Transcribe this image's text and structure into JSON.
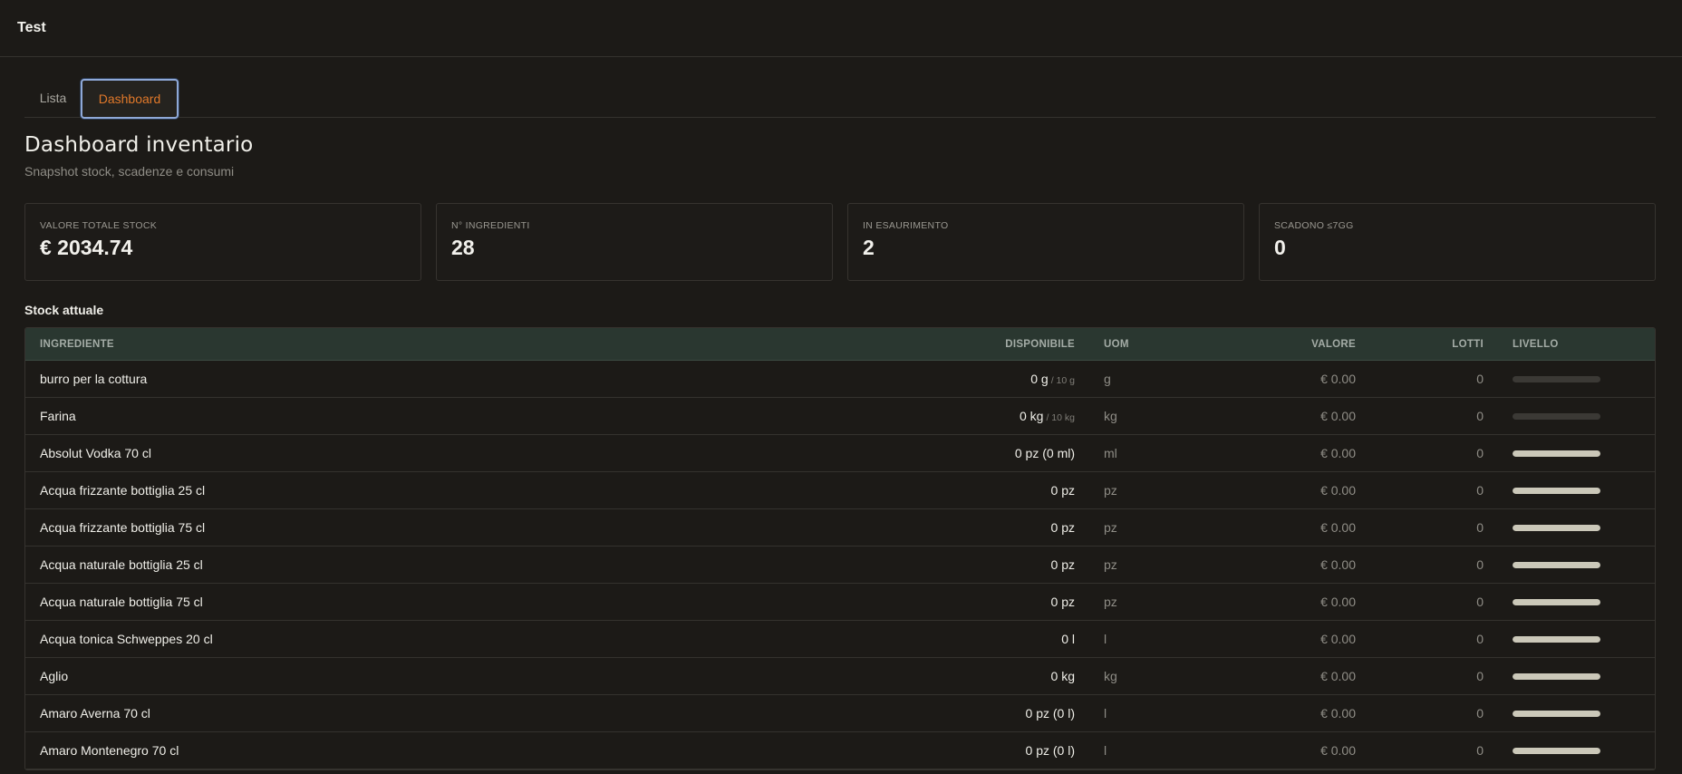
{
  "app": {
    "title": "Test"
  },
  "tabs": [
    {
      "label": "Lista",
      "active": false
    },
    {
      "label": "Dashboard",
      "active": true
    }
  ],
  "page": {
    "title": "Dashboard inventario",
    "subtitle": "Snapshot stock, scadenze e consumi"
  },
  "kpis": [
    {
      "label": "VALORE TOTALE STOCK",
      "value": "€ 2034.74"
    },
    {
      "label": "N° INGREDIENTI",
      "value": "28"
    },
    {
      "label": "IN ESAURIMENTO",
      "value": "2"
    },
    {
      "label": "SCADONO ≤7GG",
      "value": "0"
    }
  ],
  "stock": {
    "title": "Stock attuale",
    "columns": {
      "name": "INGREDIENTE",
      "available": "DISPONIBILE",
      "uom": "UOM",
      "value": "VALORE",
      "lots": "LOTTI",
      "level": "LIVELLO"
    },
    "rows": [
      {
        "name": "burro per la cottura",
        "available": "0 g",
        "threshold": "/ 10 g",
        "uom": "g",
        "value": "€ 0.00",
        "lots": "0",
        "level": 0
      },
      {
        "name": "Farina",
        "available": "0 kg",
        "threshold": "/ 10 kg",
        "uom": "kg",
        "value": "€ 0.00",
        "lots": "0",
        "level": 0
      },
      {
        "name": "Absolut Vodka 70 cl",
        "available": "0 pz (0 ml)",
        "threshold": "",
        "uom": "ml",
        "value": "€ 0.00",
        "lots": "0",
        "level": 1
      },
      {
        "name": "Acqua frizzante bottiglia 25 cl",
        "available": "0 pz",
        "threshold": "",
        "uom": "pz",
        "value": "€ 0.00",
        "lots": "0",
        "level": 1
      },
      {
        "name": "Acqua frizzante bottiglia 75 cl",
        "available": "0 pz",
        "threshold": "",
        "uom": "pz",
        "value": "€ 0.00",
        "lots": "0",
        "level": 1
      },
      {
        "name": "Acqua naturale bottiglia 25 cl",
        "available": "0 pz",
        "threshold": "",
        "uom": "pz",
        "value": "€ 0.00",
        "lots": "0",
        "level": 1
      },
      {
        "name": "Acqua naturale bottiglia 75 cl",
        "available": "0 pz",
        "threshold": "",
        "uom": "pz",
        "value": "€ 0.00",
        "lots": "0",
        "level": 1
      },
      {
        "name": "Acqua tonica Schweppes 20 cl",
        "available": "0 l",
        "threshold": "",
        "uom": "l",
        "value": "€ 0.00",
        "lots": "0",
        "level": 1
      },
      {
        "name": "Aglio",
        "available": "0 kg",
        "threshold": "",
        "uom": "kg",
        "value": "€ 0.00",
        "lots": "0",
        "level": 1
      },
      {
        "name": "Amaro Averna 70 cl",
        "available": "0 pz (0 l)",
        "threshold": "",
        "uom": "l",
        "value": "€ 0.00",
        "lots": "0",
        "level": 1
      },
      {
        "name": "Amaro Montenegro 70 cl",
        "available": "0 pz (0 l)",
        "threshold": "",
        "uom": "l",
        "value": "€ 0.00",
        "lots": "0",
        "level": 1
      }
    ]
  },
  "colors": {
    "background": "#1c1a17",
    "accent": "#e0782a",
    "table_header": "#2a3730",
    "level_fill": "#cbc8b9"
  }
}
